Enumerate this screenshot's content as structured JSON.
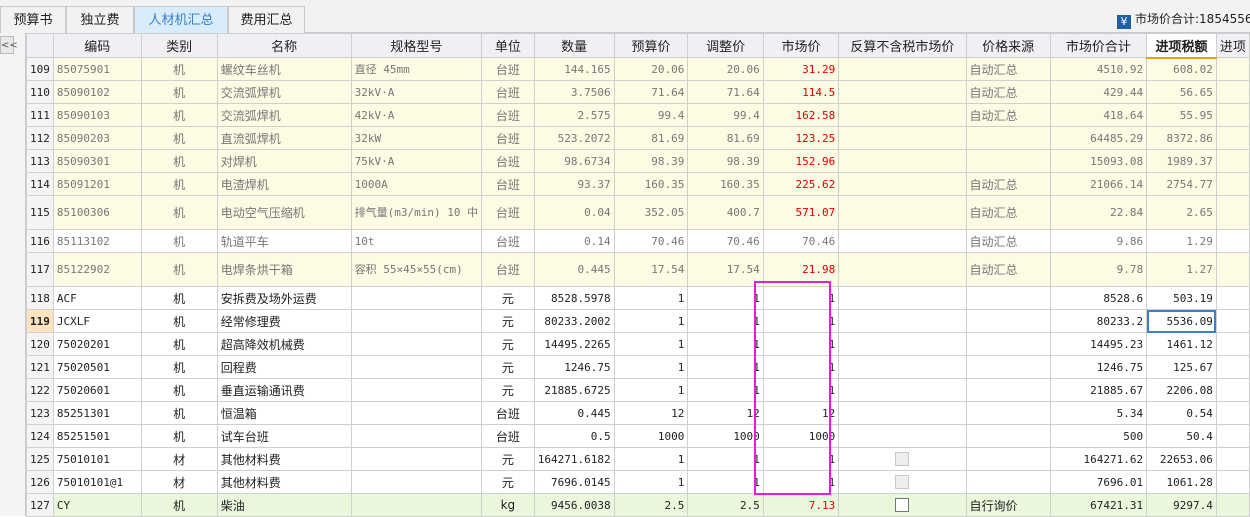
{
  "tabs": [
    {
      "label": "预算书",
      "active": false
    },
    {
      "label": "独立费",
      "active": false
    },
    {
      "label": "人材机汇总",
      "active": true
    },
    {
      "label": "费用汇总",
      "active": false
    }
  ],
  "market_total": {
    "icon": "yen-icon",
    "text": "市场价合计:1854556:"
  },
  "collapse_glyph": "<<",
  "columns": [
    "编码",
    "类别",
    "名称",
    "规格型号",
    "单位",
    "数量",
    "预算价",
    "调整价",
    "市场价",
    "反算不含税市场价",
    "价格来源",
    "市场价合计",
    "进项税额",
    "进项"
  ],
  "colors": {
    "accent": "#3b7fc4",
    "red": "#e00000",
    "highlight_box": "#e020d8",
    "yellow_row": "#fdfbe3",
    "green_row": "#e9f7dd"
  },
  "rows": [
    {
      "no": "109",
      "code": "85075901",
      "type": "机",
      "name": "螺纹车丝机",
      "spec": "直径 45mm",
      "unit": "台班",
      "qty": "144.165",
      "budget": "20.06",
      "adjusted": "20.06",
      "market": "31.29",
      "source": "自动汇总",
      "total": "4510.92",
      "tax": "608.02",
      "style": "yellow",
      "red": true
    },
    {
      "no": "110",
      "code": "85090102",
      "type": "机",
      "name": "交流弧焊机",
      "spec": "32kV·A",
      "unit": "台班",
      "qty": "3.7506",
      "budget": "71.64",
      "adjusted": "71.64",
      "market": "114.5",
      "source": "自动汇总",
      "total": "429.44",
      "tax": "56.65",
      "style": "yellow",
      "red": true
    },
    {
      "no": "111",
      "code": "85090103",
      "type": "机",
      "name": "交流弧焊机",
      "spec": "42kV·A",
      "unit": "台班",
      "qty": "2.575",
      "budget": "99.4",
      "adjusted": "99.4",
      "market": "162.58",
      "source": "自动汇总",
      "total": "418.64",
      "tax": "55.95",
      "style": "yellow",
      "red": true
    },
    {
      "no": "112",
      "code": "85090203",
      "type": "机",
      "name": "直流弧焊机",
      "spec": "32kW",
      "unit": "台班",
      "qty": "523.2072",
      "budget": "81.69",
      "adjusted": "81.69",
      "market": "123.25",
      "source": "",
      "total": "64485.29",
      "tax": "8372.86",
      "style": "yellow",
      "red": true
    },
    {
      "no": "113",
      "code": "85090301",
      "type": "机",
      "name": "对焊机",
      "spec": "75kV·A",
      "unit": "台班",
      "qty": "98.6734",
      "budget": "98.39",
      "adjusted": "98.39",
      "market": "152.96",
      "source": "",
      "total": "15093.08",
      "tax": "1989.37",
      "style": "yellow",
      "red": true
    },
    {
      "no": "114",
      "code": "85091201",
      "type": "机",
      "name": "电渣焊机",
      "spec": "1000A",
      "unit": "台班",
      "qty": "93.37",
      "budget": "160.35",
      "adjusted": "160.35",
      "market": "225.62",
      "source": "自动汇总",
      "total": "21066.14",
      "tax": "2754.77",
      "style": "yellow",
      "red": true
    },
    {
      "no": "115",
      "code": "85100306",
      "type": "机",
      "name": "电动空气压缩机",
      "spec": "排气量(m3/min) 10 中",
      "unit": "台班",
      "qty": "0.04",
      "budget": "352.05",
      "adjusted": "400.7",
      "market": "571.07",
      "source": "自动汇总",
      "total": "22.84",
      "tax": "2.65",
      "style": "yellow",
      "red": true,
      "tall": true
    },
    {
      "no": "116",
      "code": "85113102",
      "type": "机",
      "name": "轨道平车",
      "spec": "10t",
      "unit": "台班",
      "qty": "0.14",
      "budget": "70.46",
      "adjusted": "70.46",
      "market": "70.46",
      "source": "自动汇总",
      "total": "9.86",
      "tax": "1.29",
      "style": "plain-grey",
      "red": false
    },
    {
      "no": "117",
      "code": "85122902",
      "type": "机",
      "name": "电焊条烘干箱",
      "spec": "容积 55×45×55(cm)",
      "unit": "台班",
      "qty": "0.445",
      "budget": "17.54",
      "adjusted": "17.54",
      "market": "21.98",
      "source": "自动汇总",
      "total": "9.78",
      "tax": "1.27",
      "style": "yellow",
      "red": true,
      "tall": true
    },
    {
      "no": "118",
      "code": "ACF",
      "type": "机",
      "name": "安拆费及场外运费",
      "spec": "",
      "unit": "元",
      "qty": "8528.5978",
      "budget": "1",
      "adjusted": "1",
      "market": "1",
      "source": "",
      "total": "8528.6",
      "tax": "503.19",
      "style": "white",
      "red": false
    },
    {
      "no": "119",
      "code": "JCXLF",
      "type": "机",
      "name": "经常修理费",
      "spec": "",
      "unit": "元",
      "qty": "80233.2002",
      "budget": "1",
      "adjusted": "1",
      "market": "1",
      "source": "",
      "total": "80233.2",
      "tax": "5536.09",
      "style": "white",
      "red": false,
      "current": true
    },
    {
      "no": "120",
      "code": "75020201",
      "type": "机",
      "name": "超高降效机械费",
      "spec": "",
      "unit": "元",
      "qty": "14495.2265",
      "budget": "1",
      "adjusted": "1",
      "market": "1",
      "source": "",
      "total": "14495.23",
      "tax": "1461.12",
      "style": "white",
      "red": false
    },
    {
      "no": "121",
      "code": "75020501",
      "type": "机",
      "name": "回程费",
      "spec": "",
      "unit": "元",
      "qty": "1246.75",
      "budget": "1",
      "adjusted": "1",
      "market": "1",
      "source": "",
      "total": "1246.75",
      "tax": "125.67",
      "style": "white",
      "red": false
    },
    {
      "no": "122",
      "code": "75020601",
      "type": "机",
      "name": "垂直运输通讯费",
      "spec": "",
      "unit": "元",
      "qty": "21885.6725",
      "budget": "1",
      "adjusted": "1",
      "market": "1",
      "source": "",
      "total": "21885.67",
      "tax": "2206.08",
      "style": "white",
      "red": false
    },
    {
      "no": "123",
      "code": "85251301",
      "type": "机",
      "name": "恒温箱",
      "spec": "",
      "unit": "台班",
      "qty": "0.445",
      "budget": "12",
      "adjusted": "12",
      "market": "12",
      "source": "",
      "total": "5.34",
      "tax": "0.54",
      "style": "white",
      "red": false
    },
    {
      "no": "124",
      "code": "85251501",
      "type": "机",
      "name": "试车台班",
      "spec": "",
      "unit": "台班",
      "qty": "0.5",
      "budget": "1000",
      "adjusted": "1000",
      "market": "1000",
      "source": "",
      "total": "500",
      "tax": "50.4",
      "style": "white",
      "red": false
    },
    {
      "no": "125",
      "code": "75010101",
      "type": "材",
      "name": "其他材料费",
      "spec": "",
      "unit": "元",
      "qty": "164271.6182",
      "budget": "1",
      "adjusted": "1",
      "market": "1",
      "source": "",
      "total": "164271.62",
      "tax": "22653.06",
      "style": "white",
      "red": false,
      "checkbox": "off"
    },
    {
      "no": "126",
      "code": "75010101@1",
      "type": "材",
      "name": "其他材料费",
      "spec": "",
      "unit": "元",
      "qty": "7696.0145",
      "budget": "1",
      "adjusted": "1",
      "market": "1",
      "source": "",
      "total": "7696.01",
      "tax": "1061.28",
      "style": "white",
      "red": false,
      "checkbox": "off"
    },
    {
      "no": "127",
      "code": "CY",
      "type": "机",
      "name": "柴油",
      "spec": "",
      "unit": "kg",
      "qty": "9456.0038",
      "budget": "2.5",
      "adjusted": "2.5",
      "market": "7.13",
      "source": "自行询价",
      "total": "67421.31",
      "tax": "9297.4",
      "style": "green",
      "red": true,
      "checkbox": "on"
    }
  ]
}
